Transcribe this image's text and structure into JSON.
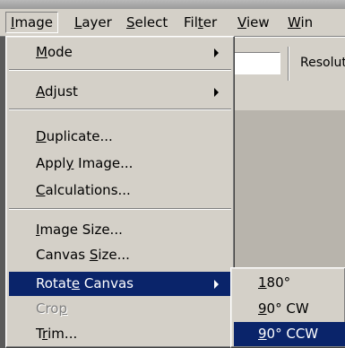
{
  "menubar": {
    "items": [
      {
        "pre": "",
        "u": "I",
        "post": "mage"
      },
      {
        "pre": "",
        "u": "L",
        "post": "ayer"
      },
      {
        "pre": "",
        "u": "S",
        "post": "elect"
      },
      {
        "pre": "Fil",
        "u": "t",
        "post": "er"
      },
      {
        "pre": "",
        "u": "V",
        "post": "iew"
      },
      {
        "pre": "",
        "u": "W",
        "post": "in"
      }
    ]
  },
  "options_bar": {
    "label": "Resolut",
    "field_value": ""
  },
  "image_menu": {
    "items": [
      {
        "pre": "",
        "u": "M",
        "post": "ode",
        "submenu": true
      },
      {
        "pre": "",
        "u": "A",
        "post": "djust",
        "submenu": true
      },
      {
        "pre": "",
        "u": "D",
        "post": "uplicate..."
      },
      {
        "pre": "Appl",
        "u": "y",
        "post": " Image..."
      },
      {
        "pre": "",
        "u": "C",
        "post": "alculations..."
      },
      {
        "pre": "",
        "u": "I",
        "post": "mage Size..."
      },
      {
        "pre": "Canvas ",
        "u": "S",
        "post": "ize..."
      },
      {
        "pre": "Rotat",
        "u": "e",
        "post": " Canvas",
        "submenu": true,
        "highlighted": true
      },
      {
        "pre": "Cro",
        "u": "p",
        "post": "",
        "disabled": true
      },
      {
        "pre": "T",
        "u": "r",
        "post": "im..."
      }
    ]
  },
  "rotate_submenu": {
    "items": [
      {
        "pre": "",
        "u": "1",
        "post": "80°"
      },
      {
        "pre": "",
        "u": "9",
        "post": "0° CW"
      },
      {
        "pre": "",
        "u": "9",
        "post": "0° CCW",
        "highlighted": true
      }
    ]
  }
}
